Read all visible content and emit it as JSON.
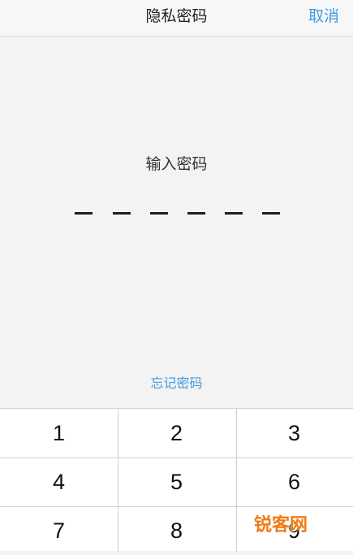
{
  "nav": {
    "title": "隐私密码",
    "cancel_label": "取消"
  },
  "main": {
    "prompt": "输入密码",
    "pin_length": 6,
    "forgot_label": "忘记密码"
  },
  "keypad": {
    "keys": [
      "1",
      "2",
      "3",
      "4",
      "5",
      "6",
      "7",
      "8",
      "9"
    ]
  },
  "watermark": {
    "text": "锐客网"
  },
  "colors": {
    "accent": "#3f9be3",
    "watermark": "#f07b12"
  }
}
